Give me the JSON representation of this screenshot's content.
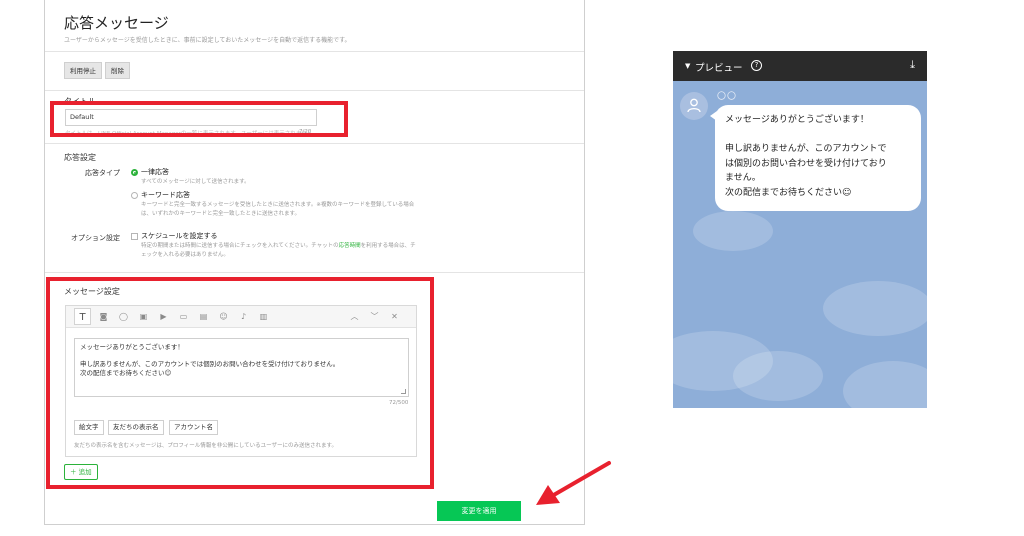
{
  "page": {
    "title": "応答メッセージ",
    "description": "ユーザーからメッセージを受信したときに、事前に設定しておいたメッセージを自動で返信する機能です。",
    "btn_suspend": "利用停止",
    "btn_delete": "削除"
  },
  "title_section": {
    "label": "タイトル",
    "value": "Default",
    "hint": "タイトルは、LINE Official Account Managerの一覧に表示されます。ユーザーには表示されません。",
    "counter": "7/20"
  },
  "response_settings": {
    "heading": "応答設定",
    "type_label": "応答タイプ",
    "opt1_title": "一律応答",
    "opt1_desc": "すべてのメッセージに対して送信されます。",
    "opt2_title": "キーワード応答",
    "opt2_desc_1": "キーワードと完全一致するメッセージを受信したときに送信されます。※複数のキーワードを登録している場合",
    "opt2_desc_2": "は、いずれかのキーワードと完全一致したときに送信されます。",
    "option_label": "オプション設定",
    "schedule_title": "スケジュールを設定する",
    "schedule_desc_1a": "特定の期間または時間に送信する場合にチェックを入れてください。チャットの",
    "schedule_desc_1_link": "応答時間",
    "schedule_desc_1b": "を利用する場合は、チ",
    "schedule_desc_2": "ェックを入れる必要はありません。"
  },
  "message_settings": {
    "heading": "メッセージ設定",
    "toolbar_icons": [
      "text-icon",
      "sticker-icon",
      "chat-icon",
      "image-icon",
      "video-icon",
      "card-icon",
      "coupon-icon",
      "smiley-icon",
      "mic-icon",
      "calendar-icon"
    ],
    "lines": [
      "メッセージありがとうございます！",
      "",
      "申し訳ありませんが、このアカウントでは個別のお問い合わせを受け付けておりません。",
      "次の配信までお待ちください☺"
    ],
    "counter": "72/500",
    "btn_emoji": "絵文字",
    "btn_friend_name": "友だちの表示名",
    "btn_account_name": "アカウント名",
    "note": "友だちの表示名を含むメッセージは、プロフィール情報を非公開にしているユーザーにのみ送信されます。",
    "add_label": "＋ 追加"
  },
  "apply_button": "変更を適用",
  "preview": {
    "title": "プレビュー",
    "sender_name": "〇〇",
    "bubble_lines": [
      "メッセージありがとうございます！",
      "",
      "申し訳ありませんが、このアカウントで",
      "は個別のお問い合わせを受け付けており",
      "ません。",
      "次の配信までお待ちください☺"
    ]
  },
  "colors": {
    "line_green": "#06c755",
    "highlight_red": "#e8212e",
    "preview_bg": "#8eaed8"
  }
}
